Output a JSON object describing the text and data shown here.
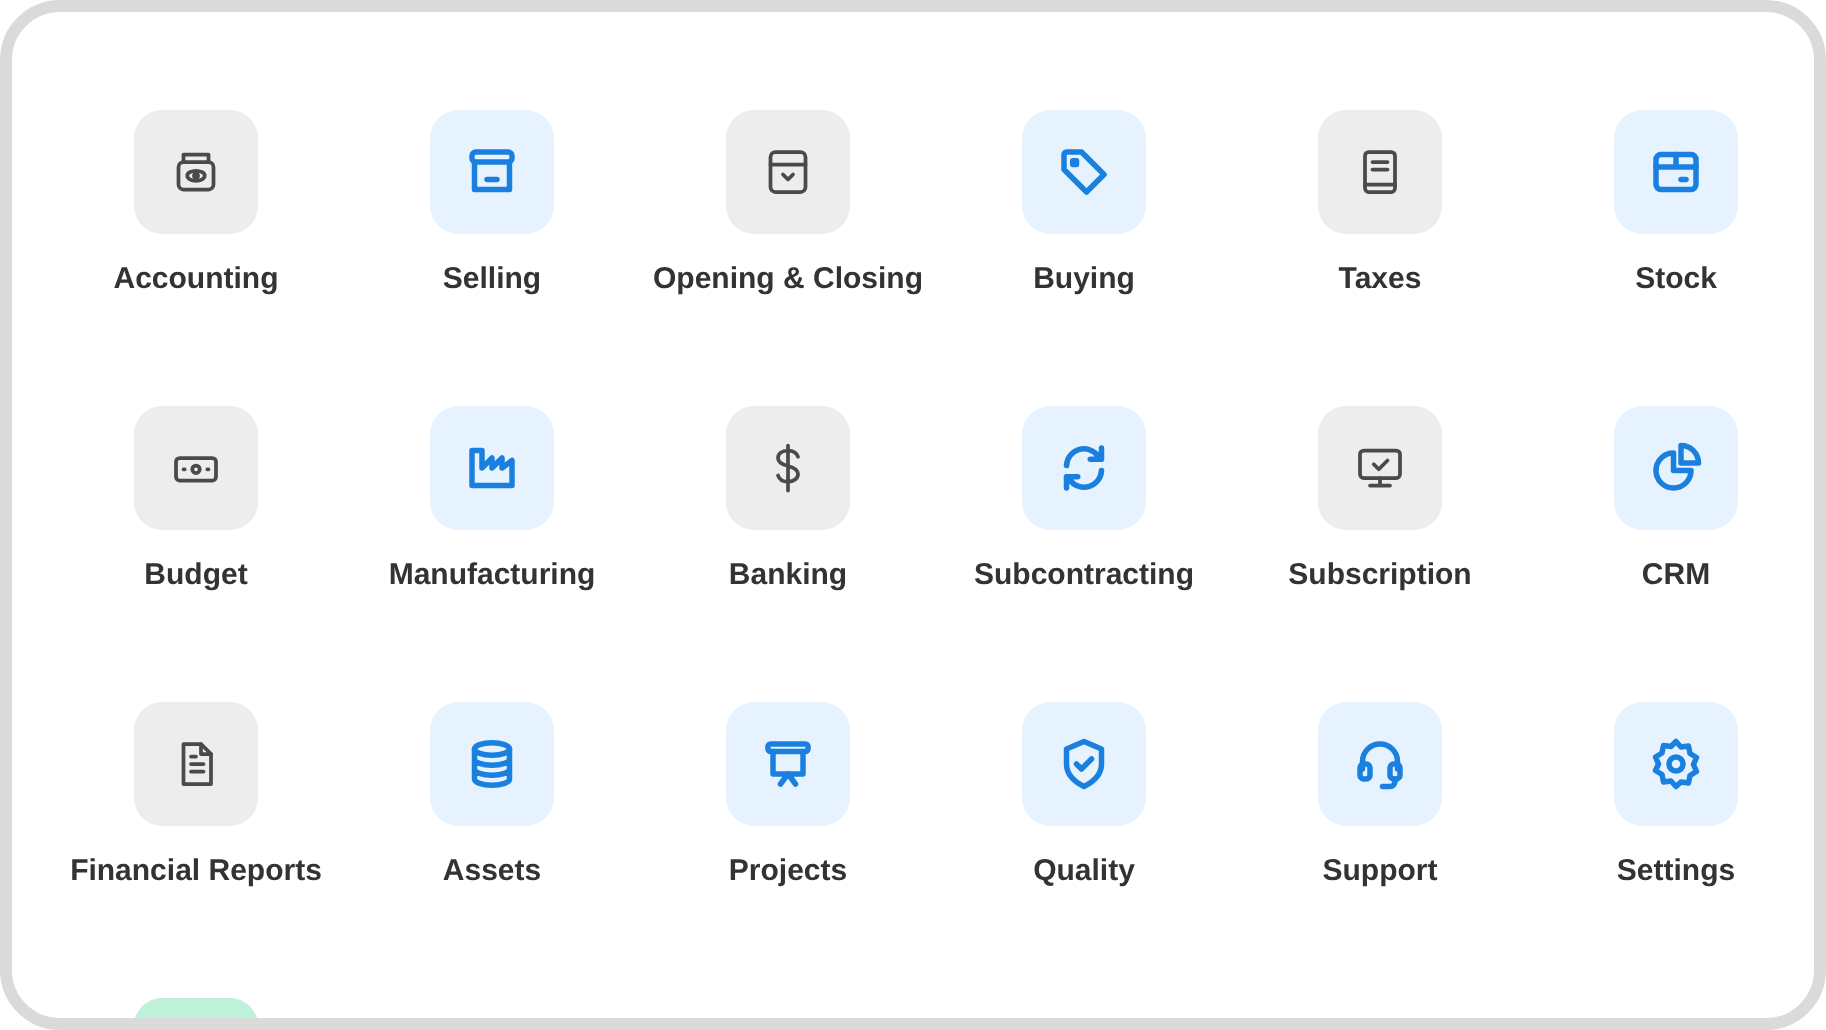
{
  "modules": [
    {
      "label": "Accounting",
      "kind": "grey"
    },
    {
      "label": "Selling",
      "kind": "blue"
    },
    {
      "label": "Opening & Closing",
      "kind": "grey"
    },
    {
      "label": "Buying",
      "kind": "blue"
    },
    {
      "label": "Taxes",
      "kind": "grey"
    },
    {
      "label": "Stock",
      "kind": "blue"
    },
    {
      "label": "Budget",
      "kind": "grey"
    },
    {
      "label": "Manufacturing",
      "kind": "blue"
    },
    {
      "label": "Banking",
      "kind": "grey"
    },
    {
      "label": "Subcontracting",
      "kind": "blue"
    },
    {
      "label": "Subscription",
      "kind": "grey"
    },
    {
      "label": "CRM",
      "kind": "blue"
    },
    {
      "label": "Financial Reports",
      "kind": "grey"
    },
    {
      "label": "Assets",
      "kind": "blue"
    },
    {
      "label": "Projects",
      "kind": "blue"
    },
    {
      "label": "Quality",
      "kind": "blue"
    },
    {
      "label": "Support",
      "kind": "blue"
    },
    {
      "label": "Settings",
      "kind": "blue"
    },
    {
      "kind": "green"
    }
  ]
}
